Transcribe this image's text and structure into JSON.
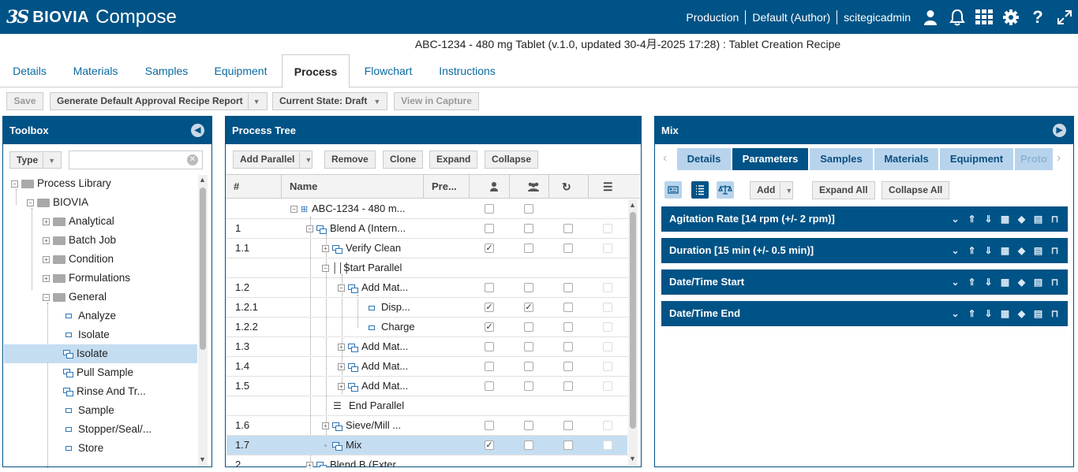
{
  "app": {
    "ds": "3S",
    "brand": "BIOVIA",
    "product": "Compose"
  },
  "header": {
    "environment": "Production",
    "role": "Default (Author)",
    "user": "scitegicadmin"
  },
  "subtitle": "ABC-1234 - 480 mg Tablet (v.1.0, updated 30-4月-2025 17:28) : Tablet Creation Recipe",
  "tabs": [
    "Details",
    "Materials",
    "Samples",
    "Equipment",
    "Process",
    "Flowchart",
    "Instructions"
  ],
  "toolbar": {
    "save": "Save",
    "report": "Generate Default Approval Recipe Report",
    "state": "Current State: Draft",
    "capture": "View in Capture"
  },
  "toolbox": {
    "title": "Toolbox",
    "type_label": "Type",
    "search_placeholder": "",
    "items": [
      {
        "label": "Process Library"
      },
      {
        "label": "BIOVIA"
      },
      {
        "label": "Analytical"
      },
      {
        "label": "Batch Job"
      },
      {
        "label": "Condition"
      },
      {
        "label": "Formulations"
      },
      {
        "label": "General"
      },
      {
        "label": "Analyze"
      },
      {
        "label": "Isolate"
      },
      {
        "label": "Isolate"
      },
      {
        "label": "Pull Sample"
      },
      {
        "label": "Rinse And Tr..."
      },
      {
        "label": "Sample"
      },
      {
        "label": "Stopper/Seal/..."
      },
      {
        "label": "Store"
      }
    ]
  },
  "process_tree": {
    "title": "Process Tree",
    "buttons": {
      "add_parallel": "Add Parallel",
      "remove": "Remove",
      "clone": "Clone",
      "expand": "Expand",
      "collapse": "Collapse"
    },
    "columns": {
      "num": "#",
      "name": "Name",
      "pre": "Pre..."
    },
    "rows": [
      {
        "num": "",
        "name": "ABC-1234 - 480 m..."
      },
      {
        "num": "1",
        "name": "Blend A (Intern..."
      },
      {
        "num": "1.1",
        "name": "Verify Clean"
      },
      {
        "num": "",
        "name": "Start Parallel"
      },
      {
        "num": "1.2",
        "name": "Add Mat..."
      },
      {
        "num": "1.2.1",
        "name": "Disp..."
      },
      {
        "num": "1.2.2",
        "name": "Charge"
      },
      {
        "num": "1.3",
        "name": "Add Mat..."
      },
      {
        "num": "1.4",
        "name": "Add Mat..."
      },
      {
        "num": "1.5",
        "name": "Add Mat..."
      },
      {
        "num": "",
        "name": "End Parallel"
      },
      {
        "num": "1.6",
        "name": "Sieve/Mill ..."
      },
      {
        "num": "1.7",
        "name": "Mix"
      },
      {
        "num": "2",
        "name": "Blend B (Exter..."
      }
    ]
  },
  "mix": {
    "title": "Mix",
    "tabs": [
      "Details",
      "Parameters",
      "Samples",
      "Materials",
      "Equipment",
      "Proto"
    ],
    "buttons": {
      "add": "Add",
      "expand_all": "Expand All",
      "collapse_all": "Collapse All"
    },
    "params": [
      "Agitation Rate [14 rpm (+/- 2 rpm)]",
      "Duration [15 min (+/- 0.5 min)]",
      "Date/Time Start",
      "Date/Time End"
    ]
  }
}
